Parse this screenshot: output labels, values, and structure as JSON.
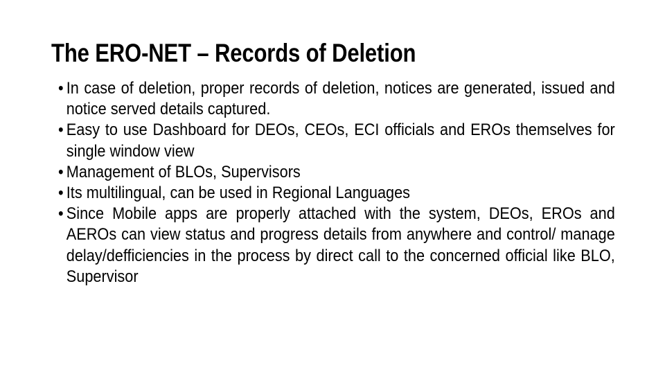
{
  "slide": {
    "title": "The ERO-NET – Records of Deletion",
    "background_color": "#ffffff",
    "text_color": "#000000",
    "bullet_marker": "•",
    "bullets": [
      {
        "text": "In case of deletion, proper records of deletion, notices are generated, issued and notice served details captured."
      },
      {
        "text": "Easy to use Dashboard for DEOs, CEOs, ECI officials and EROs themselves for single window view"
      },
      {
        "text": "Management of BLOs, Supervisors"
      },
      {
        "text": "Its multilingual, can be used in Regional Languages"
      },
      {
        "text": "Since Mobile apps are properly attached with the system, DEOs, EROs and AEROs can view status and progress details from anywhere and control/ manage delay/defficiencies in the process by direct call to the concerned official like BLO, Supervisor"
      }
    ]
  }
}
